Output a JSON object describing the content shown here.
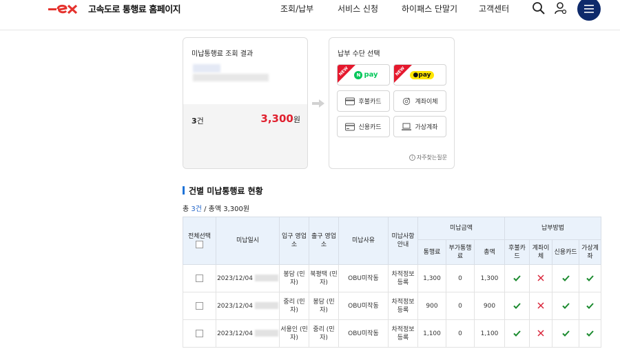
{
  "header": {
    "site_title": "고속도로 통행료 홈페이지",
    "nav": [
      "조회/납부",
      "서비스 신청",
      "하이패스 단말기",
      "고객센터"
    ],
    "brand_color": "#e5322d",
    "menu_color": "#0e2a6b"
  },
  "result_card": {
    "title": "미납통행료 조회 결과",
    "count": "3",
    "count_unit": "건",
    "amount": "3,300",
    "amount_unit": "원"
  },
  "pay_card": {
    "title": "납부 수단 선택",
    "new_label": "NEW",
    "npay": "pay",
    "kpay": "pay",
    "options": [
      "후불카드",
      "계좌이체",
      "신용카드",
      "가상계좌"
    ],
    "faq": "자주찾는질문"
  },
  "section": {
    "title": "건별 미납통행료 현황",
    "summary_prefix": "총 ",
    "summary_count": "3건",
    "summary_rest": " / 총액 3,300원"
  },
  "table": {
    "headers": {
      "select_all": "전체선택",
      "date": "미납일시",
      "entry": "입구 영업소",
      "exit": "출구 영업소",
      "reason": "미납사유",
      "guide": "미납사항 안내",
      "amount_group": "미납금액",
      "method_group": "납부방법",
      "toll": "통행료",
      "surcharge": "부가통행료",
      "total": "총액",
      "m1": "후불카드",
      "m2": "계좌이체",
      "m3": "신용카드",
      "m4": "가상계좌"
    },
    "rows": [
      {
        "date": "2023/12/04",
        "entry": "봉담 (민자)",
        "exit": "북평택 (민자)",
        "reason": "OBU미작동",
        "guide": "차적정보 등록",
        "toll": "1,300",
        "surcharge": "0",
        "total": "1,300"
      },
      {
        "date": "2023/12/04",
        "entry": "중리 (민자)",
        "exit": "봉담 (민자)",
        "reason": "OBU미작동",
        "guide": "차적정보 등록",
        "toll": "900",
        "surcharge": "0",
        "total": "900"
      },
      {
        "date": "2023/12/04",
        "entry": "서용인 (민자)",
        "exit": "중리 (민자)",
        "reason": "OBU미작동",
        "guide": "차적정보 등록",
        "toll": "1,100",
        "surcharge": "0",
        "total": "1,100"
      }
    ],
    "methods": [
      "allowed",
      "not-allowed",
      "allowed",
      "allowed"
    ]
  }
}
